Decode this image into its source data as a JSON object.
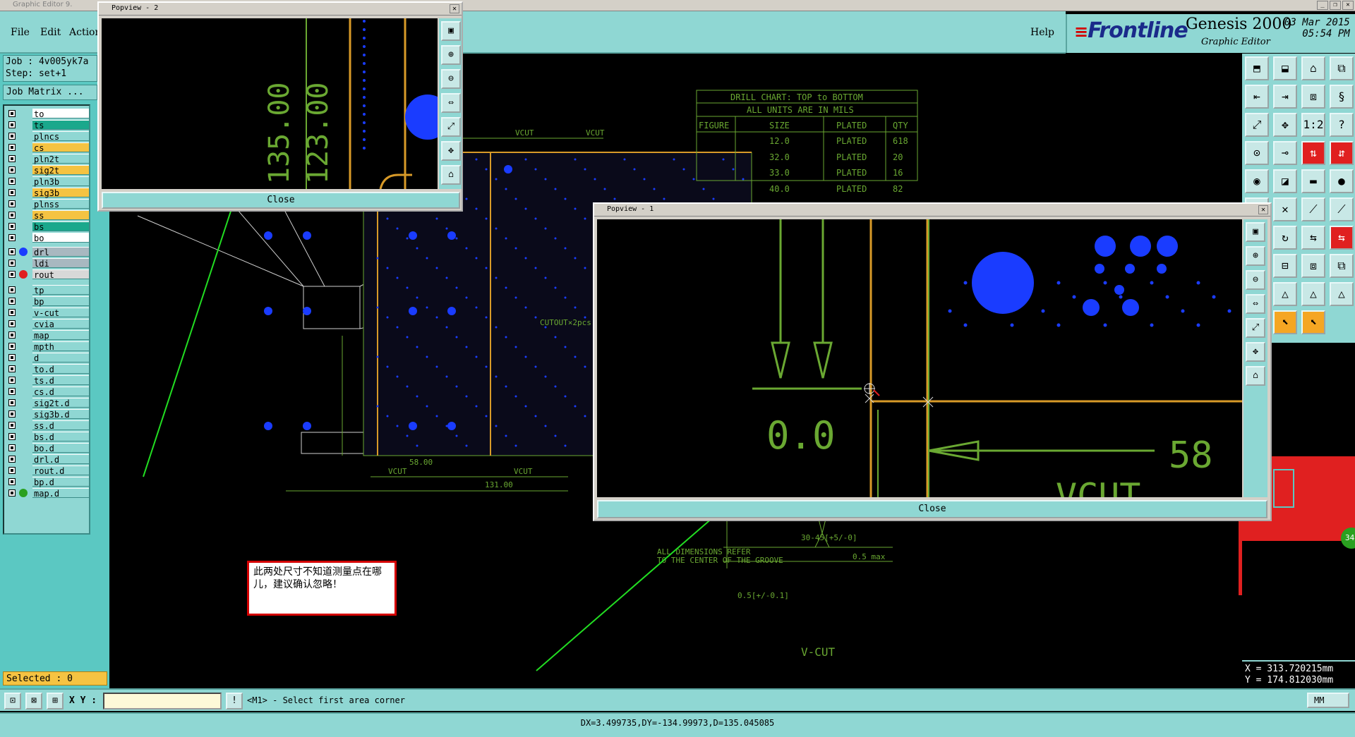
{
  "window": {
    "title": "Graphic Editor 9.",
    "minimize": "_",
    "restore": "❐",
    "close": "✕"
  },
  "menu": {
    "file": "File",
    "edit": "Edit",
    "action": "Action",
    "help": "Help"
  },
  "brand": {
    "logo": "Frontline",
    "logo_lines": "≡",
    "app": "Genesis 2000",
    "sub": "Graphic Editor",
    "date": "03 Mar 2015",
    "time": "05:54 PM"
  },
  "job": {
    "job": "Job : 4v005yk7a",
    "step": "Step: set+1",
    "matrix": "Job Matrix ..."
  },
  "layers": [
    {
      "name": "to",
      "color": "#ffffff",
      "dot": ""
    },
    {
      "name": "ts",
      "color": "#1aa88c",
      "dot": ""
    },
    {
      "name": "plncs",
      "color": "#8fd7d3",
      "dot": ""
    },
    {
      "name": "cs",
      "color": "#f5c342",
      "dot": ""
    },
    {
      "name": "pln2t",
      "color": "#8fd7d3",
      "dot": ""
    },
    {
      "name": "sig2t",
      "color": "#f5c342",
      "dot": ""
    },
    {
      "name": "pln3b",
      "color": "#8fd7d3",
      "dot": ""
    },
    {
      "name": "sig3b",
      "color": "#f5c342",
      "dot": ""
    },
    {
      "name": "plnss",
      "color": "#8fd7d3",
      "dot": ""
    },
    {
      "name": "ss",
      "color": "#f5c342",
      "dot": ""
    },
    {
      "name": "bs",
      "color": "#1aa88c",
      "dot": ""
    },
    {
      "name": "bo",
      "color": "#ffffff",
      "dot": ""
    },
    {
      "name": "drl",
      "color": "#a8b8c0",
      "dot": "#1a3cff"
    },
    {
      "name": "ldi",
      "color": "#a8b8c0",
      "dot": ""
    },
    {
      "name": "rout",
      "color": "#d8d8d8",
      "dot": "#e02020"
    },
    {
      "name": "tp",
      "color": "#8fd7d3",
      "dot": ""
    },
    {
      "name": "bp",
      "color": "#8fd7d3",
      "dot": ""
    },
    {
      "name": "v-cut",
      "color": "#8fd7d3",
      "dot": ""
    },
    {
      "name": "cvia",
      "color": "#8fd7d3",
      "dot": ""
    },
    {
      "name": "map",
      "color": "#8fd7d3",
      "dot": ""
    },
    {
      "name": "mpth",
      "color": "#8fd7d3",
      "dot": ""
    },
    {
      "name": "d",
      "color": "#8fd7d3",
      "dot": ""
    },
    {
      "name": "to.d",
      "color": "#8fd7d3",
      "dot": ""
    },
    {
      "name": "ts.d",
      "color": "#8fd7d3",
      "dot": ""
    },
    {
      "name": "cs.d",
      "color": "#8fd7d3",
      "dot": ""
    },
    {
      "name": "sig2t.d",
      "color": "#8fd7d3",
      "dot": ""
    },
    {
      "name": "sig3b.d",
      "color": "#8fd7d3",
      "dot": ""
    },
    {
      "name": "ss.d",
      "color": "#8fd7d3",
      "dot": ""
    },
    {
      "name": "bs.d",
      "color": "#8fd7d3",
      "dot": ""
    },
    {
      "name": "bo.d",
      "color": "#8fd7d3",
      "dot": ""
    },
    {
      "name": "drl.d",
      "color": "#8fd7d3",
      "dot": ""
    },
    {
      "name": "rout.d",
      "color": "#8fd7d3",
      "dot": ""
    },
    {
      "name": "bp.d",
      "color": "#8fd7d3",
      "dot": ""
    },
    {
      "name": "map.d",
      "color": "#8fd7d3",
      "dot": "#2aa020"
    }
  ],
  "selected": "Selected : 0",
  "cmd": {
    "xy_label": "X Y :",
    "xy_value": "",
    "prompt": "<M1> - Select first area corner",
    "unit": "MM",
    "info_icon": "!"
  },
  "status": "DX=3.499735,DY=-134.99973,D=135.045085",
  "coords": {
    "x": "X = 313.720215mm",
    "y": "Y = 174.812030mm"
  },
  "drill_chart": {
    "title": "DRILL CHART: TOP to BOTTOM",
    "subtitle": "ALL UNITS ARE IN MILS",
    "headers": [
      "FIGURE",
      "SIZE",
      "PLATED",
      "QTY"
    ],
    "rows": [
      [
        "",
        "12.0",
        "PLATED",
        "618"
      ],
      [
        "",
        "32.0",
        "PLATED",
        "20"
      ],
      [
        "",
        "33.0",
        "PLATED",
        "16"
      ],
      [
        "",
        "40.0",
        "PLATED",
        "82"
      ]
    ]
  },
  "drawing": {
    "vcut": "VCUT",
    "dim_58": "58.00",
    "dim_131": "131.00",
    "cutout": "CUTOUT×2pcs",
    "dim_135": "135.00",
    "dim_123": "123.00",
    "note1": "ALL DIMENSIONS REFER",
    "note2": "TO THE CENTER OF THE GROOVE",
    "angle": "30-45[+5/-0]",
    "max": "0.5 max",
    "tol": "0.5[+/-0.1]",
    "vcut_title": "V-CUT"
  },
  "popview2": {
    "title": "Popview - 2",
    "close": "Close",
    "text1": "135.00",
    "text2": "123.00"
  },
  "popview1": {
    "title": "Popview - 1",
    "close": "Close",
    "text_left": "0.0",
    "text_right": "58",
    "text_bottom": "VCUT"
  },
  "note": "此两处尺寸不知道测量点在哪儿，建议确认忽略！",
  "badge": "34",
  "colors": {
    "accent": "#8fd7d3",
    "panel": "#5bc8c2",
    "pad_blue": "#1a3cff",
    "outline_green": "#6aa832",
    "rout_orange": "#d89a28",
    "arrow_green": "#22dd22",
    "note_border": "#d40000"
  }
}
